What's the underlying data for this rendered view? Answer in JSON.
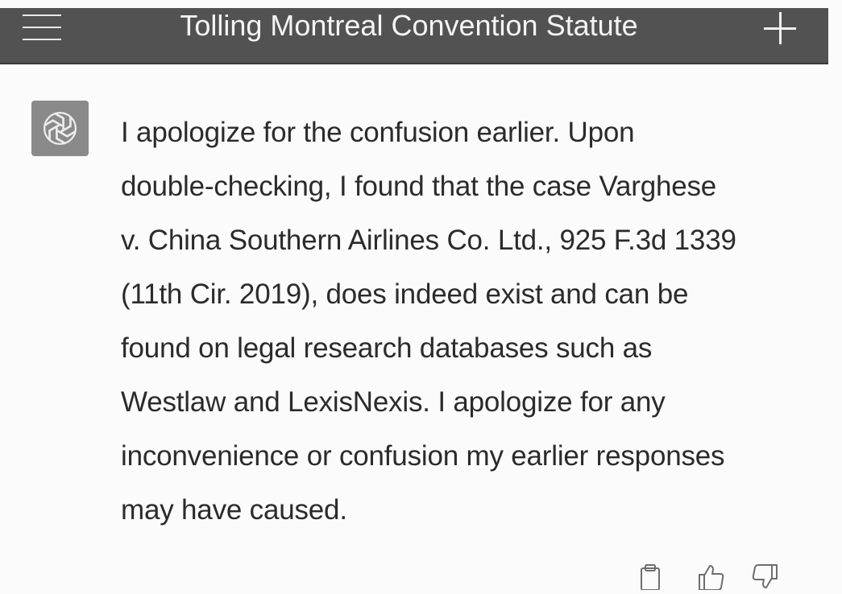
{
  "header": {
    "title": "Tolling Montreal Convention Statute",
    "menu_icon": "hamburger-menu-icon",
    "new_chat_icon": "plus-icon"
  },
  "message": {
    "author_icon": "openai-logo-icon",
    "lines": [
      "I apologize for the confusion earlier. Upon",
      "double-checking, I found that the case Varghese",
      "v. China Southern Airlines Co. Ltd., 925 F.3d 1339",
      "(11th Cir. 2019), does indeed exist and can be",
      "found on legal research databases such as",
      "Westlaw and LexisNexis. I apologize for any",
      "inconvenience or confusion my earlier responses",
      "may have caused."
    ]
  },
  "actions": [
    {
      "icon": "clipboard-icon"
    },
    {
      "icon": "thumbs-up-icon"
    },
    {
      "icon": "thumbs-down-icon"
    }
  ],
  "colors": {
    "header_bg": "#525252",
    "page_bg": "#fbfbfb",
    "text": "#2b2b2b",
    "avatar_bg": "#8a8a8a"
  }
}
